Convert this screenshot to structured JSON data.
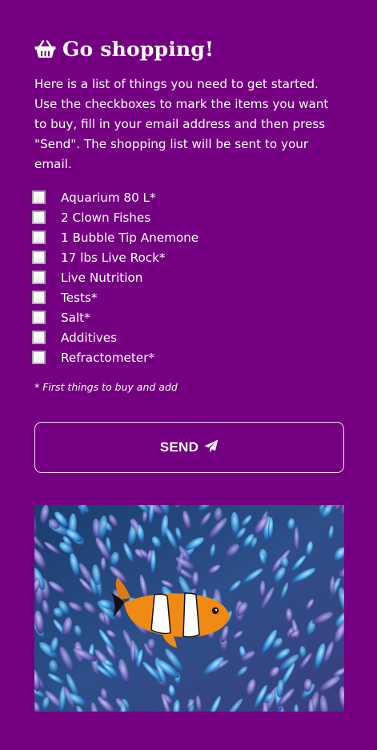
{
  "header": {
    "icon": "basket-icon",
    "title": "Go shopping!"
  },
  "intro": "Here is a list of things you need to get started. Use the checkboxes to mark the items you want to buy, fill in your email address and then press \"Send\". The shopping list will be sent to your email.",
  "items": [
    {
      "label": "Aquarium 80 L*",
      "checked": false
    },
    {
      "label": "2 Clown Fishes",
      "checked": false
    },
    {
      "label": "1 Bubble Tip Anemone",
      "checked": false
    },
    {
      "label": "17 lbs Live Rock*",
      "checked": false
    },
    {
      "label": "Live Nutrition",
      "checked": false
    },
    {
      "label": "Tests*",
      "checked": false
    },
    {
      "label": "Salt*",
      "checked": false
    },
    {
      "label": "Additives",
      "checked": false
    },
    {
      "label": "Refractometer*",
      "checked": false
    }
  ],
  "footnote": "* First things to buy and add",
  "send_button": {
    "label": "SEND",
    "icon": "paper-plane-icon"
  },
  "image": {
    "subject": "clownfish-in-anemone"
  },
  "colors": {
    "background": "#740081",
    "text": "#ffffff",
    "button_border": "#f0d9f3"
  }
}
